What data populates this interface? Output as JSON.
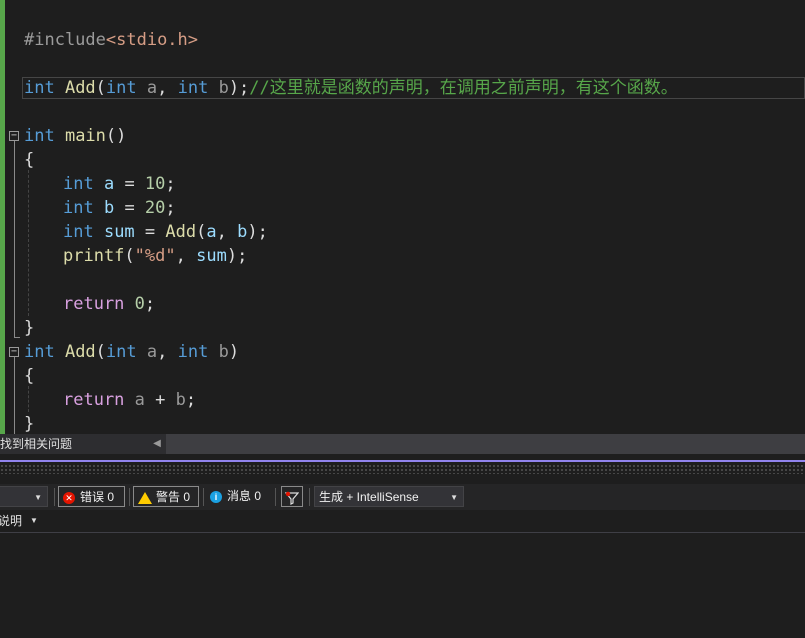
{
  "editor": {
    "lines": [
      [
        {
          "t": "#include",
          "c": "pre"
        },
        {
          "t": "<stdio.h>",
          "c": "inc"
        }
      ],
      [
        {
          "t": "int",
          "c": "kw"
        },
        {
          "t": " Add",
          "c": "fn"
        },
        {
          "t": "(",
          "c": ""
        },
        {
          "t": "int",
          "c": "kw"
        },
        {
          "t": " a",
          "c": "par"
        },
        {
          "t": ", ",
          "c": ""
        },
        {
          "t": "int",
          "c": "kw"
        },
        {
          "t": " b",
          "c": "par"
        },
        {
          "t": ");",
          "c": ""
        },
        {
          "t": "//这里就是函数的声明，在调用之前声明，有这个函数。",
          "c": "cm"
        }
      ],
      [
        {
          "t": "int",
          "c": "kw"
        },
        {
          "t": " main",
          "c": "fn"
        },
        {
          "t": "()",
          "c": ""
        }
      ],
      [
        {
          "t": "{",
          "c": ""
        }
      ],
      [
        {
          "t": "int",
          "c": "kw"
        },
        {
          "t": " a",
          "c": "var"
        },
        {
          "t": " = ",
          "c": ""
        },
        {
          "t": "10",
          "c": "num"
        },
        {
          "t": ";",
          "c": ""
        }
      ],
      [
        {
          "t": "int",
          "c": "kw"
        },
        {
          "t": " b",
          "c": "var"
        },
        {
          "t": " = ",
          "c": ""
        },
        {
          "t": "20",
          "c": "num"
        },
        {
          "t": ";",
          "c": ""
        }
      ],
      [
        {
          "t": "int",
          "c": "kw"
        },
        {
          "t": " sum",
          "c": "var"
        },
        {
          "t": " = ",
          "c": ""
        },
        {
          "t": "Add",
          "c": "fn"
        },
        {
          "t": "(",
          "c": ""
        },
        {
          "t": "a",
          "c": "var"
        },
        {
          "t": ", ",
          "c": ""
        },
        {
          "t": "b",
          "c": "var"
        },
        {
          "t": ");",
          "c": ""
        }
      ],
      [
        {
          "t": "printf",
          "c": "fn"
        },
        {
          "t": "(",
          "c": ""
        },
        {
          "t": "\"%d\"",
          "c": "str"
        },
        {
          "t": ", ",
          "c": ""
        },
        {
          "t": "sum",
          "c": "var"
        },
        {
          "t": ");",
          "c": ""
        }
      ],
      [
        {
          "t": "return",
          "c": "ctl"
        },
        {
          "t": " ",
          "c": ""
        },
        {
          "t": "0",
          "c": "num"
        },
        {
          "t": ";",
          "c": ""
        }
      ],
      [
        {
          "t": "}",
          "c": ""
        }
      ],
      [
        {
          "t": "int",
          "c": "kw"
        },
        {
          "t": " Add",
          "c": "fn"
        },
        {
          "t": "(",
          "c": ""
        },
        {
          "t": "int",
          "c": "kw"
        },
        {
          "t": " a",
          "c": "par"
        },
        {
          "t": ", ",
          "c": ""
        },
        {
          "t": "int",
          "c": "kw"
        },
        {
          "t": " b",
          "c": "par"
        },
        {
          "t": ")",
          "c": ""
        }
      ],
      [
        {
          "t": "{",
          "c": ""
        }
      ],
      [
        {
          "t": "return",
          "c": "ctl"
        },
        {
          "t": " a",
          "c": "par"
        },
        {
          "t": " + ",
          "c": ""
        },
        {
          "t": "b",
          "c": "par"
        },
        {
          "t": ";",
          "c": ""
        }
      ],
      [
        {
          "t": "}",
          "c": ""
        }
      ]
    ]
  },
  "statusbar": {
    "issues_text": "未找到相关问题",
    "scroll_left_icon": "chevron-left-icon"
  },
  "error_list": {
    "scope_dropdown_value": "",
    "errors_label": "错误 0",
    "warnings_label": "警告 0",
    "messages_label": "消息 0",
    "filter_icon": "filter-icon",
    "source_dropdown_value": "生成 + IntelliSense",
    "column_header": "说明"
  },
  "colors": {
    "accent": "#9184ee",
    "keyword": "#569cd6",
    "comment": "#57a64a",
    "error": "#e51400",
    "warning": "#ffcc00",
    "info": "#1ba1e2"
  }
}
